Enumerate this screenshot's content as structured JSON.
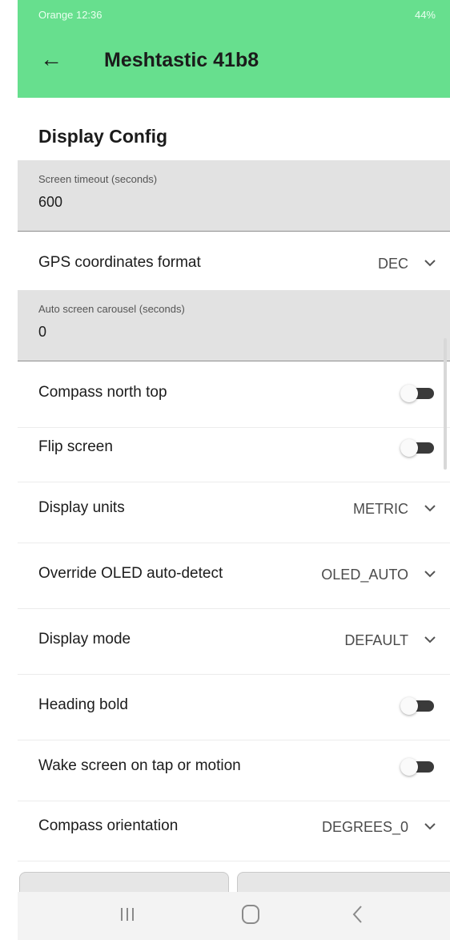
{
  "status_bar": {
    "left": "Orange 12:36",
    "right": "44%"
  },
  "app_bar": {
    "back_icon": "arrow-left-icon",
    "title": "Meshtastic 41b8"
  },
  "section_title": "Display Config",
  "fields": [
    {
      "label": "Screen timeout (seconds)",
      "value": "600"
    },
    {
      "label": "Auto screen carousel (seconds)",
      "value": "0"
    }
  ],
  "rows": [
    {
      "label": "GPS coordinates format",
      "value": "DEC"
    },
    {
      "label": "Compass north top"
    },
    {
      "label": "Flip screen"
    },
    {
      "label": "Display units",
      "value": "METRIC"
    },
    {
      "label": "Override OLED auto-detect",
      "value": "OLED_AUTO"
    },
    {
      "label": "Display mode",
      "value": "DEFAULT"
    },
    {
      "label": "Heading bold"
    },
    {
      "label": "Wake screen on tap or motion"
    },
    {
      "label": "Compass orientation",
      "value": "DEGREES_0"
    }
  ],
  "toggles": {
    "compass_north_top": false,
    "flip_screen": false,
    "heading_bold": false,
    "wake_screen": false
  },
  "colors": {
    "accent": "#67df8e",
    "field_bg": "#e2e2e2",
    "toggle_off_track": "#3a3a3a"
  },
  "nav_bar": {
    "icons": [
      "recent-apps-icon",
      "home-icon",
      "back-icon"
    ]
  }
}
